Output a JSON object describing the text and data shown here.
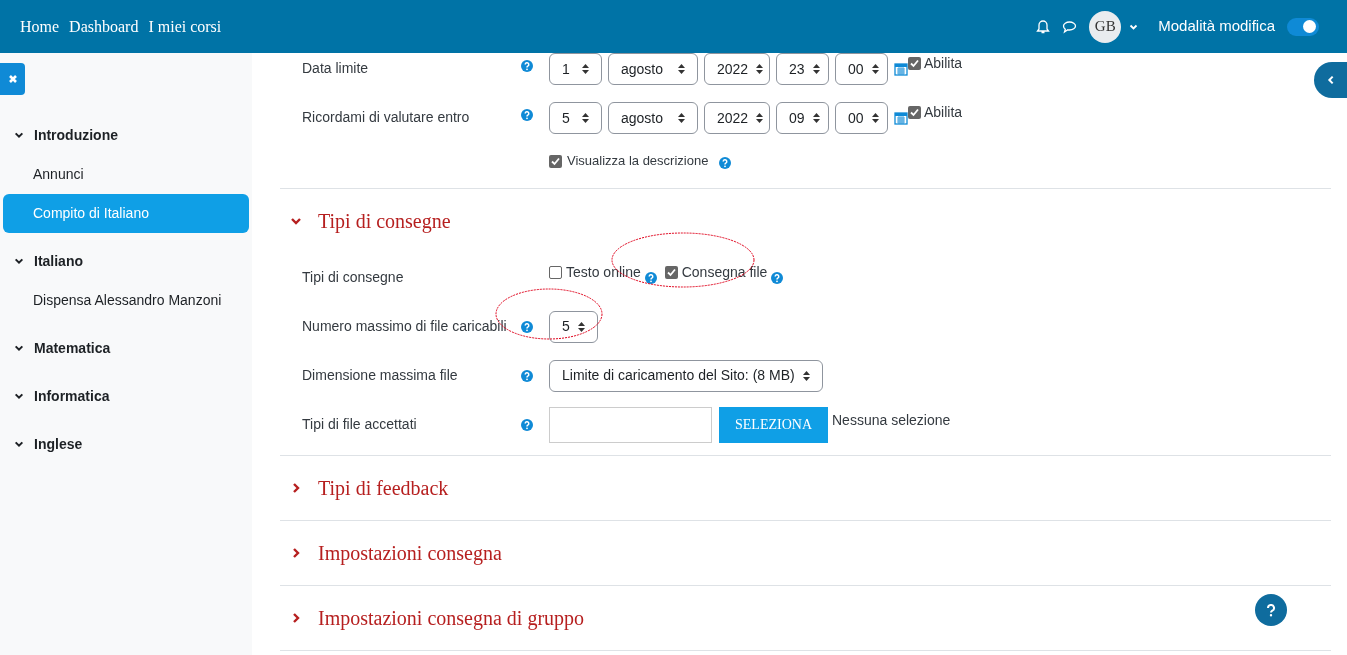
{
  "navbar": {
    "links": [
      "Home",
      "Dashboard",
      "I miei corsi"
    ],
    "avatar": "GB",
    "edit_mode": {
      "label": "Modalità modifica",
      "on": true
    }
  },
  "sidebar": {
    "sections": [
      {
        "title": "Introduzione",
        "expanded": true,
        "items": [
          {
            "label": "Annunci",
            "selected": false
          },
          {
            "label": "Compito di Italiano",
            "selected": true
          }
        ]
      },
      {
        "title": "Italiano",
        "expanded": true,
        "items": [
          {
            "label": "Dispensa Alessandro Manzoni",
            "selected": false
          }
        ]
      },
      {
        "title": "Matematica",
        "expanded": true
      },
      {
        "title": "Informatica",
        "expanded": true
      },
      {
        "title": "Inglese",
        "expanded": true
      }
    ]
  },
  "date_rows": [
    {
      "label": "Data limite",
      "selects": [
        "1",
        "agosto",
        "2022",
        "23",
        "00"
      ],
      "enable": {
        "label": "Abilita",
        "checked": true
      }
    },
    {
      "label": "Ricordami di valutare entro",
      "selects": [
        "5",
        "agosto",
        "2022",
        "09",
        "00"
      ],
      "enable": {
        "label": "Abilita",
        "checked": true
      }
    }
  ],
  "show_description": {
    "label": "Visualizza la descrizione",
    "checked": true
  },
  "sections": [
    {
      "title": "Tipi di consegne",
      "expanded": true,
      "fields": [
        {
          "kind": "checkboxes",
          "label": "Tipi di consegne",
          "options": [
            {
              "label": "Testo online",
              "checked": false
            },
            {
              "label": "Consegna file",
              "checked": true
            }
          ]
        },
        {
          "kind": "select",
          "label": "Numero massimo di file caricabili",
          "value": "5"
        },
        {
          "kind": "select",
          "label": "Dimensione massima file",
          "value": "Limite di caricamento del Sito: (8 MB)"
        },
        {
          "kind": "filepicker",
          "label": "Tipi di file accettati",
          "button": "SELEZIONA",
          "note": "Nessuna selezione"
        }
      ]
    },
    {
      "title": "Tipi di feedback",
      "expanded": false
    },
    {
      "title": "Impostazioni consegna",
      "expanded": false
    },
    {
      "title": "Impostazioni consegna di gruppo",
      "expanded": false
    }
  ]
}
